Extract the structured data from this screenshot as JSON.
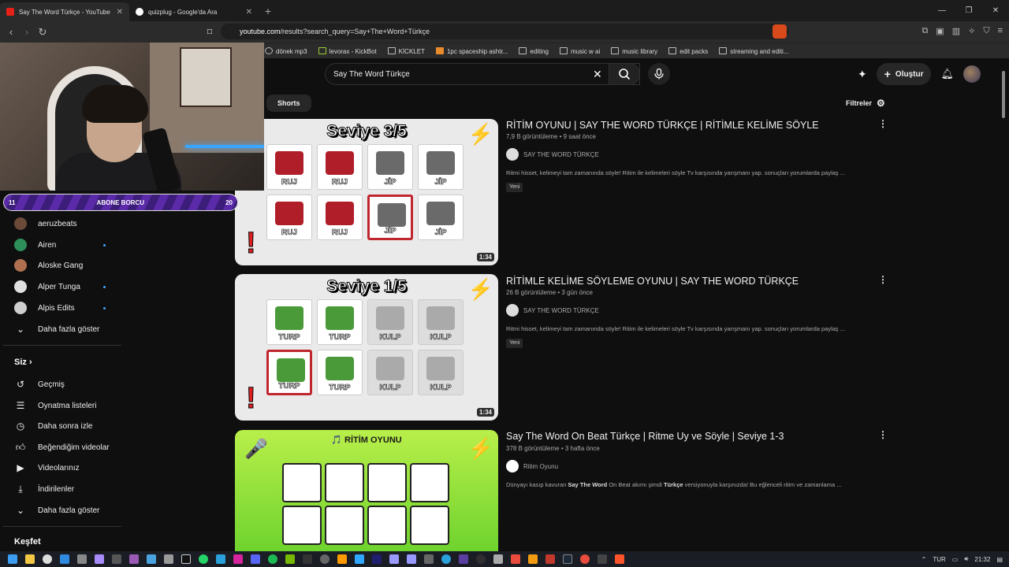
{
  "browser": {
    "tabs": [
      {
        "title": "Say The Word Türkçe - YouTube",
        "active": true
      },
      {
        "title": "quizplug - Google'da Ara",
        "active": false
      }
    ],
    "new_tab": "+",
    "url_host": "youtube.com",
    "url_path": "/results?search_query=Say+The+Word+Türkçe",
    "bookmarks": [
      "dönek mp3",
      "levorax - KickBot",
      "KİCKLET",
      "1pc spaceship ashtr...",
      "editing",
      "music w ai",
      "music library",
      "edit packs",
      "streaming and editi..."
    ]
  },
  "stream_overlay": {
    "left_count": "11",
    "label": "ABONE BORCU",
    "right_count": "20"
  },
  "sidebar": {
    "subscriptions": [
      {
        "name": "aeruzbeats",
        "color": "#6b4a3a",
        "live": false
      },
      {
        "name": "Airen",
        "color": "#2f8f5a",
        "live": true
      },
      {
        "name": "Aloske Gang",
        "color": "#b07050",
        "live": false
      },
      {
        "name": "Alper Tunga",
        "color": "#e0e0e0",
        "live": true
      },
      {
        "name": "Alpis Edits",
        "color": "#cfcfcf",
        "live": true
      }
    ],
    "show_more": "Daha fazla göster",
    "you_header": "Siz",
    "you_items": [
      {
        "label": "Geçmiş",
        "icon": "history-icon",
        "glyph": "↺"
      },
      {
        "label": "Oynatma listeleri",
        "icon": "playlist-icon",
        "glyph": "☰"
      },
      {
        "label": "Daha sonra izle",
        "icon": "clock-icon",
        "glyph": "◷"
      },
      {
        "label": "Beğendiğim videolar",
        "icon": "thumbs-up-icon",
        "glyph": "👍"
      },
      {
        "label": "Videolarınız",
        "icon": "your-videos-icon",
        "glyph": "▶"
      },
      {
        "label": "İndirilenler",
        "icon": "download-icon",
        "glyph": "⤓"
      }
    ],
    "show_more_2": "Daha fazla göster",
    "explore_header": "Keşfet"
  },
  "youtube": {
    "search_value": "Say The Word Türkçe",
    "create_label": "Oluştur",
    "chip_shorts": "Shorts",
    "filters_label": "Filtreler"
  },
  "results": [
    {
      "title": "RİTİM OYUNU | SAY THE WORD TÜRKÇE | RİTİMLE KELİME SÖYLE",
      "meta": "7,9 B görüntüleme • 9 saat önce",
      "channel": "SAY THE WORD TÜRKÇE",
      "desc": "Ritmi hisset, kelimeyi tam zamanında söyle! Ritim ile kelimeleri söyle Tv karşısında yarışmanı yap. sonuçları yorumlarda paylaş ...",
      "badge": "Yeni",
      "duration": "1:34",
      "thumb_level": "Seviye 3/5",
      "words": [
        "RUJ",
        "RUJ",
        "JİP",
        "JİP",
        "RUJ",
        "RUJ",
        "JİP",
        "JİP"
      ]
    },
    {
      "title": "RİTİMLE KELİME SÖYLEME OYUNU | SAY THE WORD TÜRKÇE",
      "meta": "26 B görüntüleme • 3 gün önce",
      "channel": "SAY THE WORD TÜRKÇE",
      "desc": "Ritmi hisset, kelimeyi tam zamanında söyle! Ritim ile kelimeleri söyle Tv karşısında yarışmanı yap. sonuçları yorumlarda paylaş ...",
      "badge": "Yeni",
      "duration": "1:34",
      "thumb_level": "Seviye 1/5",
      "words": [
        "TURP",
        "TURP",
        "KULP",
        "KULP",
        "TURP",
        "TURP",
        "KULP",
        "KULP"
      ]
    },
    {
      "title": "Say The Word On Beat Türkçe | Ritme Uy ve Söyle | Seviye 1-3",
      "meta": "378 B görüntüleme • 3 hafta önce",
      "channel": "Ritim Oyunu",
      "desc_pre": "Dünyayı kasıp kavuran ",
      "desc_b1": "Say The Word",
      "desc_mid": " On Beat akımı şimdi ",
      "desc_b2": "Türkçe",
      "desc_post": " versiyonuyla karşınızda! Bu eğlenceli ritim ve zamanlama ...",
      "thumb_title": "🎵 RİTİM OYUNU"
    }
  ],
  "taskbar": {
    "lang": "TUR",
    "time": "21:32"
  }
}
